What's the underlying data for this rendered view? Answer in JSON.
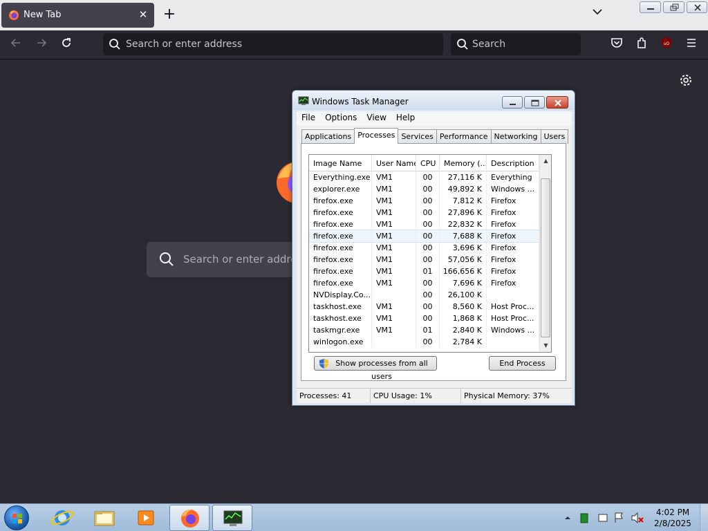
{
  "browser": {
    "tab_title": "New Tab",
    "url_placeholder": "Search or enter address",
    "search_placeholder": "Search",
    "newtab_search_placeholder": "Search or enter address"
  },
  "taskmanager": {
    "title": "Windows Task Manager",
    "menu": [
      "File",
      "Options",
      "View",
      "Help"
    ],
    "tabs": [
      "Applications",
      "Processes",
      "Services",
      "Performance",
      "Networking",
      "Users"
    ],
    "active_tab": "Processes",
    "columns": [
      "Image Name",
      "User Name",
      "CPU",
      "Memory (...",
      "Description"
    ],
    "rows": [
      {
        "name": "Everything.exe",
        "user": "VM1",
        "cpu": "00",
        "mem": "27,116 K",
        "desc": "Everything"
      },
      {
        "name": "explorer.exe",
        "user": "VM1",
        "cpu": "00",
        "mem": "49,892 K",
        "desc": "Windows ..."
      },
      {
        "name": "firefox.exe",
        "user": "VM1",
        "cpu": "00",
        "mem": "7,812 K",
        "desc": "Firefox"
      },
      {
        "name": "firefox.exe",
        "user": "VM1",
        "cpu": "00",
        "mem": "27,896 K",
        "desc": "Firefox"
      },
      {
        "name": "firefox.exe",
        "user": "VM1",
        "cpu": "00",
        "mem": "22,832 K",
        "desc": "Firefox"
      },
      {
        "name": "firefox.exe",
        "user": "VM1",
        "cpu": "00",
        "mem": "7,688 K",
        "desc": "Firefox"
      },
      {
        "name": "firefox.exe",
        "user": "VM1",
        "cpu": "00",
        "mem": "3,696 K",
        "desc": "Firefox"
      },
      {
        "name": "firefox.exe",
        "user": "VM1",
        "cpu": "00",
        "mem": "57,056 K",
        "desc": "Firefox"
      },
      {
        "name": "firefox.exe",
        "user": "VM1",
        "cpu": "01",
        "mem": "166,656 K",
        "desc": "Firefox"
      },
      {
        "name": "firefox.exe",
        "user": "VM1",
        "cpu": "00",
        "mem": "7,696 K",
        "desc": "Firefox"
      },
      {
        "name": "NVDisplay.Co...",
        "user": "",
        "cpu": "00",
        "mem": "26,100 K",
        "desc": ""
      },
      {
        "name": "taskhost.exe",
        "user": "VM1",
        "cpu": "00",
        "mem": "8,560 K",
        "desc": "Host Proc..."
      },
      {
        "name": "taskhost.exe",
        "user": "VM1",
        "cpu": "00",
        "mem": "1,868 K",
        "desc": "Host Proc..."
      },
      {
        "name": "taskmgr.exe",
        "user": "VM1",
        "cpu": "01",
        "mem": "2,840 K",
        "desc": "Windows ..."
      },
      {
        "name": "winlogon.exe",
        "user": "",
        "cpu": "00",
        "mem": "2,784 K",
        "desc": ""
      }
    ],
    "selected_row": 5,
    "show_all_button": "Show processes from all users",
    "end_process_button": "End Process",
    "status": {
      "processes": "Processes: 41",
      "cpu": "CPU Usage: 1%",
      "memory": "Physical Memory: 37%"
    }
  },
  "taskbar": {
    "time": "4:02 PM",
    "date": "2/8/2025"
  }
}
